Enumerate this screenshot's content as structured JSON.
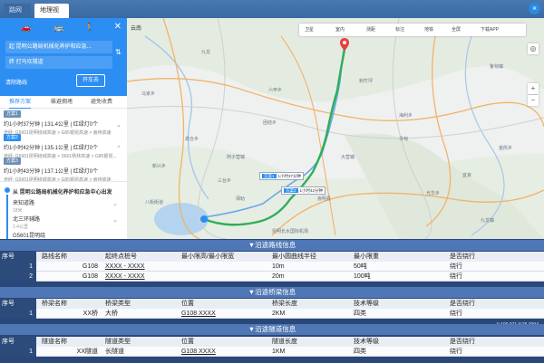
{
  "tabs": [
    {
      "label": "路网视图",
      "active": false
    },
    {
      "label": "地理视图",
      "active": true
    }
  ],
  "route_panel": {
    "modes": [
      "car-icon",
      "bus-icon",
      "walk-icon"
    ],
    "origin": "起  昆明公路局机械化养护和应急...",
    "destination": "终  打马坎隧道",
    "clear_label": "清除路线",
    "start_label": "开车去"
  },
  "plan_tabs": [
    "推荐方案",
    "躲避拥堵",
    "避免收费"
  ],
  "plans": [
    {
      "tag": "方案1",
      "summary": "约1小时37分钟  |  131.4公里  |  红绿灯0个",
      "via": "途经: G5601昆明绕城高速 > G85银昆高速 > 嵩待高速"
    },
    {
      "tag": "方案2",
      "summary": "约1小时42分钟  |  135.1公里  |  红绿灯0个",
      "via": "途经: G5601昆明绕城高速 > S601杨林高速 > G85银昆..."
    },
    {
      "tag": "方案3",
      "summary": "约1小时43分钟  |  137.1公里  |  红绿灯0个",
      "via": "途经: G5601昆明绕城高速 > G85银昆高速 > 嵩待高速"
    }
  ],
  "steps": {
    "start": "从 昆明公路局机械化养护和应急中心出发",
    "items": [
      {
        "title": "来知道路",
        "sub": "18米"
      },
      {
        "title": "北三环辅路",
        "sub": "2.4公里"
      },
      {
        "title": "G5601昆明绕",
        "sub": ""
      }
    ]
  },
  "map": {
    "city": "云南",
    "toolbar": [
      "卫星",
      "室内",
      "测距",
      "标注",
      "地铁",
      "全屏",
      "下载APP"
    ],
    "labels": [
      "九龙",
      "六甲乡",
      "马家乡",
      "团结乡",
      "高仓乡",
      "刺竹坪",
      "新兴乡",
      "海利乡",
      "大营镇",
      "三台乡",
      "阿子营镇",
      "宜良",
      "昆明长水国际机场",
      "嵩明县",
      "寻甸",
      "禄劝",
      "九龙镇",
      "光华乡",
      "金所乡",
      "鲁甸镇",
      "八街街道"
    ],
    "info1": {
      "tag": "方案1",
      "text": "1小时37分钟"
    },
    "info2": {
      "tag": "方案2",
      "text": "1小时42分钟"
    },
    "scale": "X:100.971 Y:25.3094"
  },
  "route_section": {
    "title": "▼沿途路线信息",
    "headers": [
      "序号",
      "路线名称",
      "起终点桩号",
      "最小限高/最小限宽",
      "最小圆曲线半径",
      "最小限重",
      "是否绕行"
    ],
    "rows": [
      [
        "1",
        "G108",
        "XXXX - XXXX",
        "",
        "10m",
        "50吨",
        "绕行"
      ],
      [
        "2",
        "G108",
        "XXXX - XXXX",
        "",
        "20m",
        "100吨",
        "绕行"
      ]
    ]
  },
  "bridge_section": {
    "title": "▼沿途桥梁信息",
    "headers": [
      "序号",
      "桥梁名称",
      "桥梁类型",
      "位置",
      "桥梁长度",
      "技术等级",
      "是否绕行"
    ],
    "rows": [
      [
        "1",
        "XX桥",
        "大桥",
        "G108 XXXX",
        "2KM",
        "四类",
        "绕行"
      ]
    ]
  },
  "tunnel_section": {
    "title": "▼沿途隧道信息",
    "headers": [
      "序号",
      "隧道名称",
      "隧道类型",
      "位置",
      "隧道长度",
      "技术等级",
      "是否绕行"
    ],
    "rows": [
      [
        "1",
        "XX隧道",
        "长隧道",
        "G108 XXXX",
        "1KM",
        "四类",
        "绕行"
      ]
    ]
  }
}
